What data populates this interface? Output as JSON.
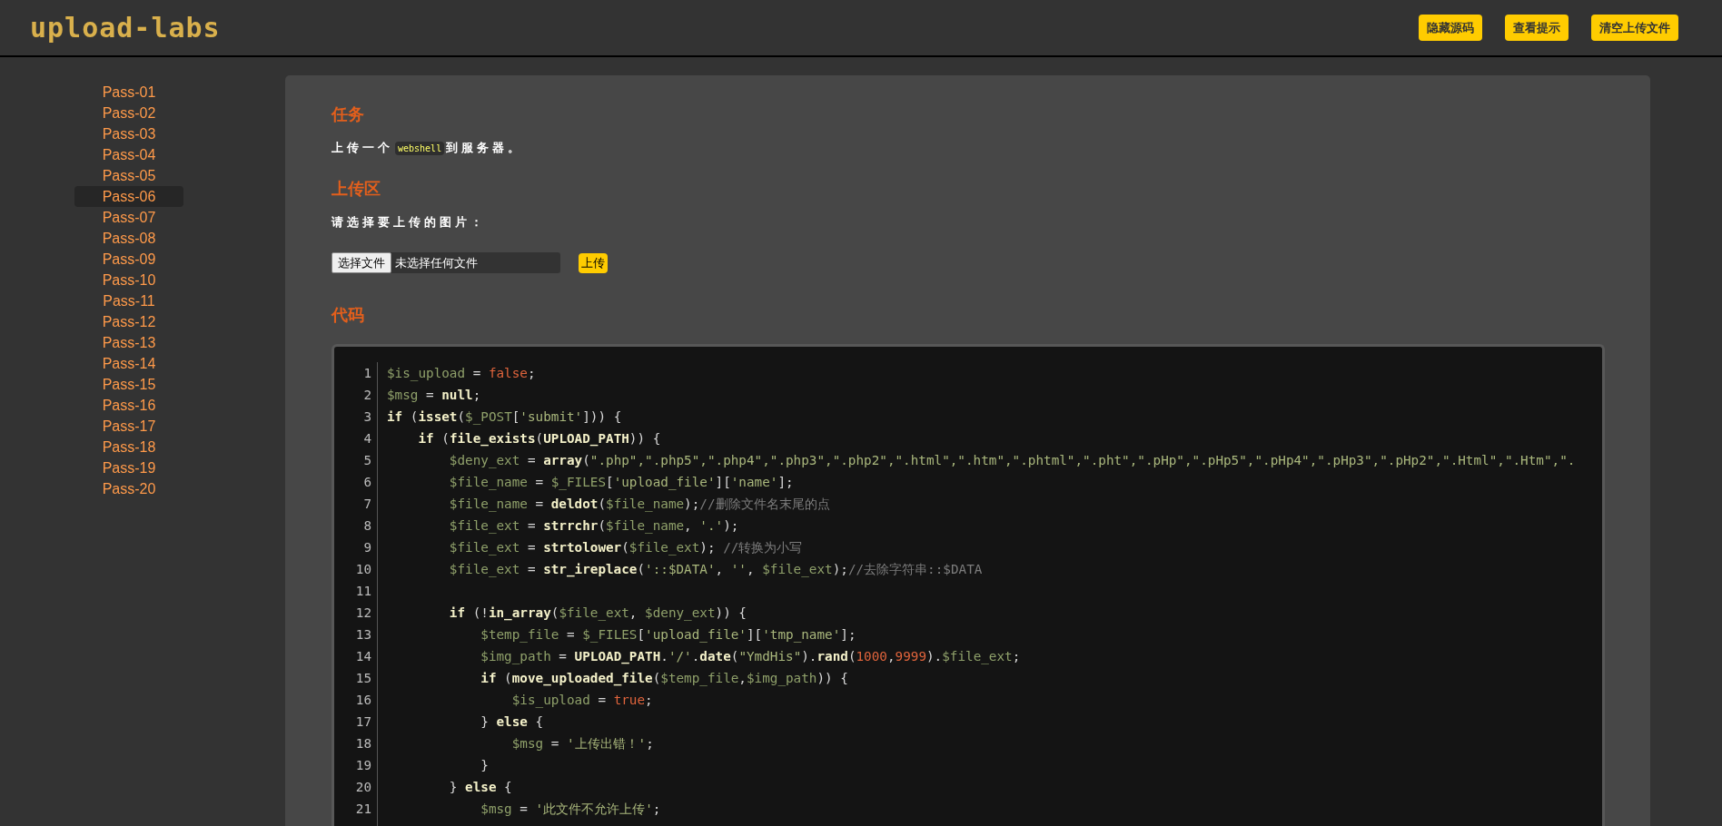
{
  "header": {
    "logo": "upload-labs",
    "buttons": [
      "隐藏源码",
      "查看提示",
      "清空上传文件"
    ]
  },
  "sidebar": {
    "items": [
      {
        "label": "Pass-01",
        "selected": false
      },
      {
        "label": "Pass-02",
        "selected": false
      },
      {
        "label": "Pass-03",
        "selected": false
      },
      {
        "label": "Pass-04",
        "selected": false
      },
      {
        "label": "Pass-05",
        "selected": false
      },
      {
        "label": "Pass-06",
        "selected": true
      },
      {
        "label": "Pass-07",
        "selected": false
      },
      {
        "label": "Pass-08",
        "selected": false
      },
      {
        "label": "Pass-09",
        "selected": false
      },
      {
        "label": "Pass-10",
        "selected": false
      },
      {
        "label": "Pass-11",
        "selected": false
      },
      {
        "label": "Pass-12",
        "selected": false
      },
      {
        "label": "Pass-13",
        "selected": false
      },
      {
        "label": "Pass-14",
        "selected": false
      },
      {
        "label": "Pass-15",
        "selected": false
      },
      {
        "label": "Pass-16",
        "selected": false
      },
      {
        "label": "Pass-17",
        "selected": false
      },
      {
        "label": "Pass-18",
        "selected": false
      },
      {
        "label": "Pass-19",
        "selected": false
      },
      {
        "label": "Pass-20",
        "selected": false
      }
    ]
  },
  "task": {
    "heading": "任务",
    "before": "上传一个",
    "code": "webshell",
    "after": "到服务器。"
  },
  "upload": {
    "heading": "上传区",
    "prompt": "请选择要上传的图片：",
    "file_button": "选择文件",
    "file_status": "未选择任何文件",
    "submit": "上传"
  },
  "code": {
    "heading": "代码",
    "lines": [
      {
        "number": "1",
        "segments": [
          {
            "kind": "variable",
            "text": "$is_upload"
          },
          {
            "kind": "plain",
            "text": " = "
          },
          {
            "kind": "literal",
            "text": "false"
          },
          {
            "kind": "plain",
            "text": ";"
          }
        ]
      },
      {
        "number": "2",
        "segments": [
          {
            "kind": "variable",
            "text": "$msg"
          },
          {
            "kind": "plain",
            "text": " = "
          },
          {
            "kind": "keyword",
            "text": "null"
          },
          {
            "kind": "plain",
            "text": ";"
          }
        ]
      },
      {
        "number": "3",
        "segments": [
          {
            "kind": "keyword",
            "text": "if"
          },
          {
            "kind": "plain",
            "text": " ("
          },
          {
            "kind": "keyword",
            "text": "isset"
          },
          {
            "kind": "plain",
            "text": "("
          },
          {
            "kind": "variable",
            "text": "$_POST"
          },
          {
            "kind": "plain",
            "text": "["
          },
          {
            "kind": "string",
            "text": "'submit'"
          },
          {
            "kind": "plain",
            "text": "])) {"
          }
        ]
      },
      {
        "number": "4",
        "segments": [
          {
            "kind": "keyword",
            "text": "    if"
          },
          {
            "kind": "plain",
            "text": " ("
          },
          {
            "kind": "keyword",
            "text": "file_exists"
          },
          {
            "kind": "plain",
            "text": "("
          },
          {
            "kind": "keyword",
            "text": "UPLOAD_PATH"
          },
          {
            "kind": "plain",
            "text": ")) {"
          }
        ]
      },
      {
        "number": "5",
        "segments": [
          {
            "kind": "variable",
            "text": "        $deny_ext"
          },
          {
            "kind": "plain",
            "text": " = "
          },
          {
            "kind": "keyword",
            "text": "array"
          },
          {
            "kind": "plain",
            "text": "("
          },
          {
            "kind": "string",
            "text": "\".php\",\".php5\",\".php4\",\".php3\",\".php2\",\".html\",\".htm\",\".phtml\",\".pht\",\".pHp\",\".pHp5\",\".pHp4\",\".pHp3\",\".pHp2\",\".Html\",\".Htm\",\"."
          }
        ]
      },
      {
        "number": "6",
        "segments": [
          {
            "kind": "variable",
            "text": "        $file_name"
          },
          {
            "kind": "plain",
            "text": " = "
          },
          {
            "kind": "variable",
            "text": "$_FILES"
          },
          {
            "kind": "plain",
            "text": "["
          },
          {
            "kind": "string",
            "text": "'upload_file'"
          },
          {
            "kind": "plain",
            "text": "]["
          },
          {
            "kind": "string",
            "text": "'name'"
          },
          {
            "kind": "plain",
            "text": "];"
          }
        ]
      },
      {
        "number": "7",
        "segments": [
          {
            "kind": "variable",
            "text": "        $file_name"
          },
          {
            "kind": "plain",
            "text": " = "
          },
          {
            "kind": "keyword",
            "text": "deldot"
          },
          {
            "kind": "plain",
            "text": "("
          },
          {
            "kind": "variable",
            "text": "$file_name"
          },
          {
            "kind": "plain",
            "text": ");"
          },
          {
            "kind": "comment",
            "text": "//删除文件名末尾的点"
          }
        ]
      },
      {
        "number": "8",
        "segments": [
          {
            "kind": "variable",
            "text": "        $file_ext"
          },
          {
            "kind": "plain",
            "text": " = "
          },
          {
            "kind": "keyword",
            "text": "strrchr"
          },
          {
            "kind": "plain",
            "text": "("
          },
          {
            "kind": "variable",
            "text": "$file_name"
          },
          {
            "kind": "plain",
            "text": ", "
          },
          {
            "kind": "string",
            "text": "'.'"
          },
          {
            "kind": "plain",
            "text": ");"
          }
        ]
      },
      {
        "number": "9",
        "segments": [
          {
            "kind": "variable",
            "text": "        $file_ext"
          },
          {
            "kind": "plain",
            "text": " = "
          },
          {
            "kind": "keyword",
            "text": "strtolower"
          },
          {
            "kind": "plain",
            "text": "("
          },
          {
            "kind": "variable",
            "text": "$file_ext"
          },
          {
            "kind": "plain",
            "text": "); "
          },
          {
            "kind": "comment",
            "text": "//转换为小写"
          }
        ]
      },
      {
        "number": "10",
        "segments": [
          {
            "kind": "variable",
            "text": "        $file_ext"
          },
          {
            "kind": "plain",
            "text": " = "
          },
          {
            "kind": "keyword",
            "text": "str_ireplace"
          },
          {
            "kind": "plain",
            "text": "("
          },
          {
            "kind": "string",
            "text": "'::$DATA'"
          },
          {
            "kind": "plain",
            "text": ", "
          },
          {
            "kind": "string",
            "text": "''"
          },
          {
            "kind": "plain",
            "text": ", "
          },
          {
            "kind": "variable",
            "text": "$file_ext"
          },
          {
            "kind": "plain",
            "text": ");"
          },
          {
            "kind": "comment",
            "text": "//去除字符串::$DATA"
          }
        ]
      },
      {
        "number": "11"
      },
      {
        "number": "12",
        "segments": [
          {
            "kind": "keyword",
            "text": "        if"
          },
          {
            "kind": "plain",
            "text": " (!"
          },
          {
            "kind": "keyword",
            "text": "in_array"
          },
          {
            "kind": "plain",
            "text": "("
          },
          {
            "kind": "variable",
            "text": "$file_ext"
          },
          {
            "kind": "plain",
            "text": ", "
          },
          {
            "kind": "variable",
            "text": "$deny_ext"
          },
          {
            "kind": "plain",
            "text": ")) {"
          }
        ]
      },
      {
        "number": "13",
        "segments": [
          {
            "kind": "variable",
            "text": "            $temp_file"
          },
          {
            "kind": "plain",
            "text": " = "
          },
          {
            "kind": "variable",
            "text": "$_FILES"
          },
          {
            "kind": "plain",
            "text": "["
          },
          {
            "kind": "string",
            "text": "'upload_file'"
          },
          {
            "kind": "plain",
            "text": "]["
          },
          {
            "kind": "string",
            "text": "'tmp_name'"
          },
          {
            "kind": "plain",
            "text": "];"
          }
        ]
      },
      {
        "number": "14",
        "segments": [
          {
            "kind": "variable",
            "text": "            $img_path"
          },
          {
            "kind": "plain",
            "text": " = "
          },
          {
            "kind": "keyword",
            "text": "UPLOAD_PATH"
          },
          {
            "kind": "plain",
            "text": "."
          },
          {
            "kind": "string",
            "text": "'/'"
          },
          {
            "kind": "plain",
            "text": "."
          },
          {
            "kind": "keyword",
            "text": "date"
          },
          {
            "kind": "plain",
            "text": "("
          },
          {
            "kind": "string",
            "text": "\"YmdHis\""
          },
          {
            "kind": "plain",
            "text": ")."
          },
          {
            "kind": "keyword",
            "text": "rand"
          },
          {
            "kind": "plain",
            "text": "("
          },
          {
            "kind": "literal",
            "text": "1000"
          },
          {
            "kind": "plain",
            "text": ","
          },
          {
            "kind": "literal",
            "text": "9999"
          },
          {
            "kind": "plain",
            "text": ")."
          },
          {
            "kind": "variable",
            "text": "$file_ext"
          },
          {
            "kind": "plain",
            "text": ";"
          }
        ]
      },
      {
        "number": "15",
        "segments": [
          {
            "kind": "keyword",
            "text": "            if"
          },
          {
            "kind": "plain",
            "text": " ("
          },
          {
            "kind": "keyword",
            "text": "move_uploaded_file"
          },
          {
            "kind": "plain",
            "text": "("
          },
          {
            "kind": "variable",
            "text": "$temp_file"
          },
          {
            "kind": "plain",
            "text": ","
          },
          {
            "kind": "variable",
            "text": "$img_path"
          },
          {
            "kind": "plain",
            "text": ")) {"
          }
        ]
      },
      {
        "number": "16",
        "segments": [
          {
            "kind": "variable",
            "text": "                $is_upload"
          },
          {
            "kind": "plain",
            "text": " = "
          },
          {
            "kind": "literal",
            "text": "true"
          },
          {
            "kind": "plain",
            "text": ";"
          }
        ]
      },
      {
        "number": "17",
        "segments": [
          {
            "kind": "plain",
            "text": "            } "
          },
          {
            "kind": "keyword",
            "text": "else"
          },
          {
            "kind": "plain",
            "text": " {"
          }
        ]
      },
      {
        "number": "18",
        "segments": [
          {
            "kind": "variable",
            "text": "                $msg"
          },
          {
            "kind": "plain",
            "text": " = "
          },
          {
            "kind": "string",
            "text": "'上传出错！'"
          },
          {
            "kind": "plain",
            "text": ";"
          }
        ]
      },
      {
        "number": "19",
        "segments": [
          {
            "kind": "plain",
            "text": "            }"
          }
        ]
      },
      {
        "number": "20",
        "segments": [
          {
            "kind": "plain",
            "text": "        } "
          },
          {
            "kind": "keyword",
            "text": "else"
          },
          {
            "kind": "plain",
            "text": " {"
          }
        ]
      },
      {
        "number": "21",
        "segments": [
          {
            "kind": "variable",
            "text": "            $msg"
          },
          {
            "kind": "plain",
            "text": " = "
          },
          {
            "kind": "string",
            "text": "'此文件不允许上传'"
          },
          {
            "kind": "plain",
            "text": ";"
          }
        ]
      }
    ]
  }
}
